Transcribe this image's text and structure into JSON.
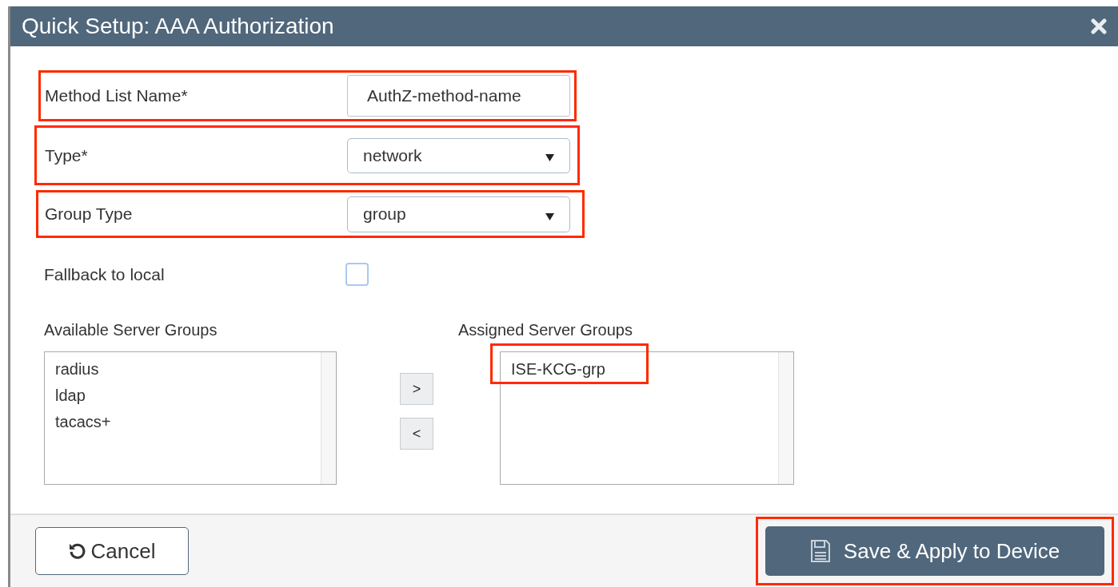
{
  "dialog": {
    "title": "Quick Setup: AAA Authorization",
    "fields": [
      {
        "kind": "text",
        "label": "Method List Name*",
        "value": "AuthZ-method-name",
        "highlighted": true
      },
      {
        "kind": "select",
        "label": "Type*",
        "value": "network",
        "highlighted": true
      },
      {
        "kind": "select",
        "label": "Group Type",
        "value": "group",
        "highlighted": true
      },
      {
        "kind": "checkbox",
        "label": "Fallback to local",
        "checked": false
      }
    ],
    "available_server_groups": {
      "label": "Available Server Groups",
      "items": [
        {
          "text": "radius",
          "highlighted": false
        },
        {
          "text": "ldap",
          "highlighted": false
        },
        {
          "text": "tacacs+",
          "highlighted": false
        }
      ]
    },
    "move_buttons": [
      ">",
      "<"
    ],
    "assigned_server_groups": {
      "label": "Assigned Server Groups",
      "items": [
        {
          "text": "ISE-KCG-grp",
          "highlighted": true
        }
      ]
    },
    "buttons": [
      {
        "kind": "cancel",
        "label": "Cancel",
        "highlighted": false
      },
      {
        "kind": "save",
        "label": "Save & Apply to Device",
        "highlighted": true
      }
    ]
  }
}
